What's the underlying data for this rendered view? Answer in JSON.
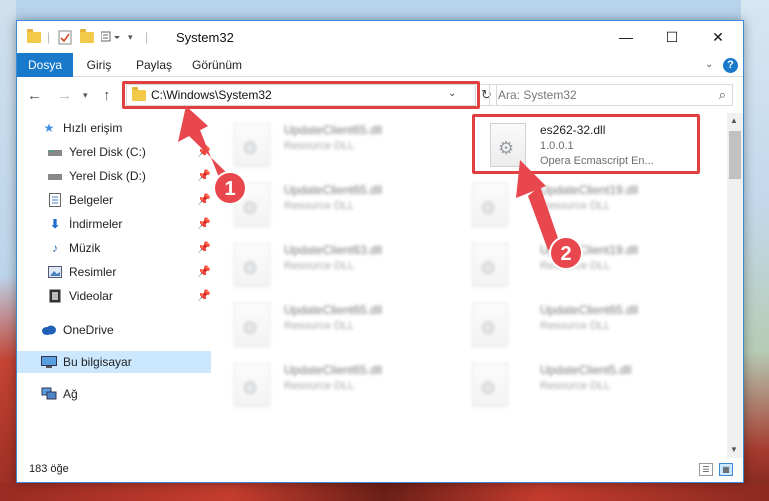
{
  "window": {
    "title": "System32",
    "controls": {
      "minimize": "—",
      "maximize": "☐",
      "close": "✕"
    }
  },
  "ribbon": {
    "tabs": [
      "Dosya",
      "Giriş",
      "Paylaş",
      "Görünüm"
    ]
  },
  "nav": {
    "address": "C:\\Windows\\System32",
    "search_placeholder": "Ara: System32"
  },
  "sidebar": {
    "items": [
      {
        "label": "Hızlı erişim",
        "icon": "star-icon"
      },
      {
        "label": "Yerel Disk (C:)",
        "icon": "drive-icon",
        "pinned": true
      },
      {
        "label": "Yerel Disk (D:)",
        "icon": "drive-icon",
        "pinned": true
      },
      {
        "label": "Belgeler",
        "icon": "documents-icon",
        "pinned": true
      },
      {
        "label": "İndirmeler",
        "icon": "download-icon",
        "pinned": true
      },
      {
        "label": "Müzik",
        "icon": "music-icon",
        "pinned": true
      },
      {
        "label": "Resimler",
        "icon": "pictures-icon",
        "pinned": true
      },
      {
        "label": "Videolar",
        "icon": "videos-icon",
        "pinned": true
      },
      {
        "label": "OneDrive",
        "icon": "cloud-icon"
      },
      {
        "label": "Bu bilgisayar",
        "icon": "computer-icon",
        "selected": true
      },
      {
        "label": "Ağ",
        "icon": "network-icon"
      }
    ]
  },
  "files": {
    "left_column": [
      {
        "name": "UpdateClient65.dll",
        "type": "Resource DLL"
      },
      {
        "name": "UpdateClient65.dll",
        "type": "Resource DLL"
      },
      {
        "name": "UpdateClient63.dll",
        "type": "Resource DLL"
      },
      {
        "name": "UpdateClient65.dll",
        "type": "Resource DLL"
      },
      {
        "name": "UpdateClient65.dll",
        "type": "Resource DLL"
      }
    ],
    "right_column": [
      {
        "name": "es262-32.dll",
        "version": "1.0.0.1",
        "type": "Opera Ecmascript En...",
        "highlighted": true
      },
      {
        "name": "UpdateClient19.dll",
        "type": "Resource DLL"
      },
      {
        "name": "UpdateClient19.dll",
        "type": "Resource DLL"
      },
      {
        "name": "UpdateClient65.dll",
        "type": "Resource DLL"
      },
      {
        "name": "UpdateClient5.dll",
        "type": "Resource DLL"
      }
    ]
  },
  "status": {
    "item_count": "183 öğe"
  },
  "annotations": {
    "step1": "1",
    "step2": "2",
    "arrow_color": "#e8474e"
  }
}
